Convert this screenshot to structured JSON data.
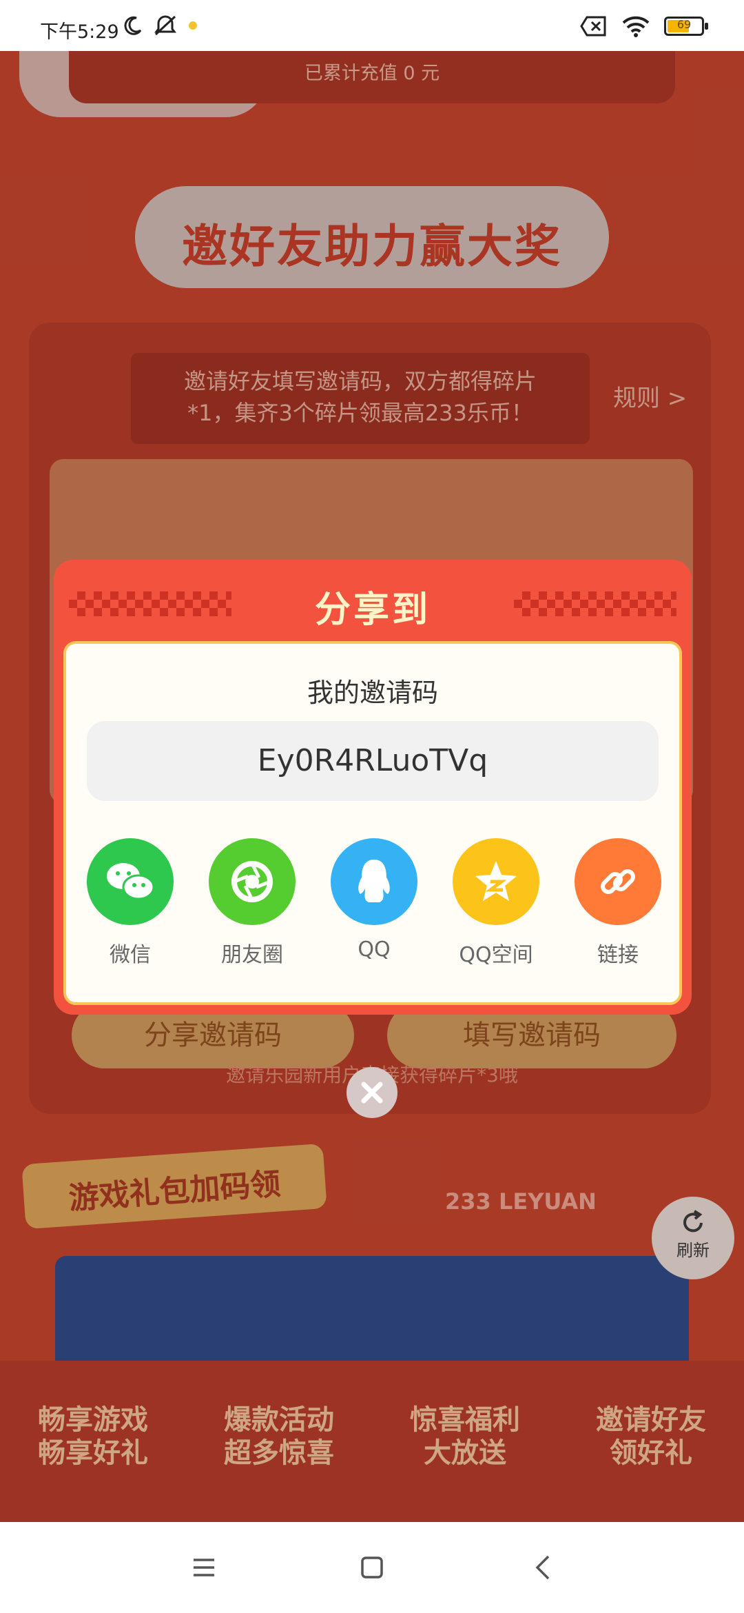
{
  "status_bar": {
    "time": "下午5:29",
    "battery_level": "69"
  },
  "page": {
    "recharge_text": "已累计充值 0 元",
    "section_title": "邀好友助力赢大奖",
    "invite_desc_line1": "邀请好友填写邀请码，双方都得碎片",
    "invite_desc_line2": "*1，集齐3个碎片领最高233乐币！",
    "rules_link": "规则 >",
    "bg_share_button": "分享邀请码",
    "bg_fill_button": "填写邀请码",
    "bg_footer_text": "邀请乐园新用户直接获得碎片*3哦",
    "gift_tag": "游戏礼包加码领",
    "leyuan_text": "233 LEYUAN",
    "refresh_label": "刷新",
    "bottom_labels": [
      {
        "line1": "畅享游戏",
        "line2": "畅享好礼"
      },
      {
        "line1": "爆款活动",
        "line2": "超多惊喜"
      },
      {
        "line1": "惊喜福利",
        "line2": "大放送"
      },
      {
        "line1": "邀请好友",
        "line2": "领好礼"
      }
    ]
  },
  "modal": {
    "title": "分享到",
    "code_label": "我的邀请码",
    "invite_code": "Ey0R4RLuoTVq",
    "share_targets": [
      {
        "label": "微信",
        "icon": "wechat-icon",
        "color": "#2dc84d"
      },
      {
        "label": "朋友圈",
        "icon": "moments-icon",
        "color": "#55cc2f"
      },
      {
        "label": "QQ",
        "icon": "qq-icon",
        "color": "#35b2f3"
      },
      {
        "label": "QQ空间",
        "icon": "qzone-icon",
        "color": "#fcc419"
      },
      {
        "label": "链接",
        "icon": "link-icon",
        "color": "#ff7a36"
      }
    ]
  },
  "colors": {
    "modal_header": "#f3533e",
    "modal_border": "#f6c659"
  }
}
